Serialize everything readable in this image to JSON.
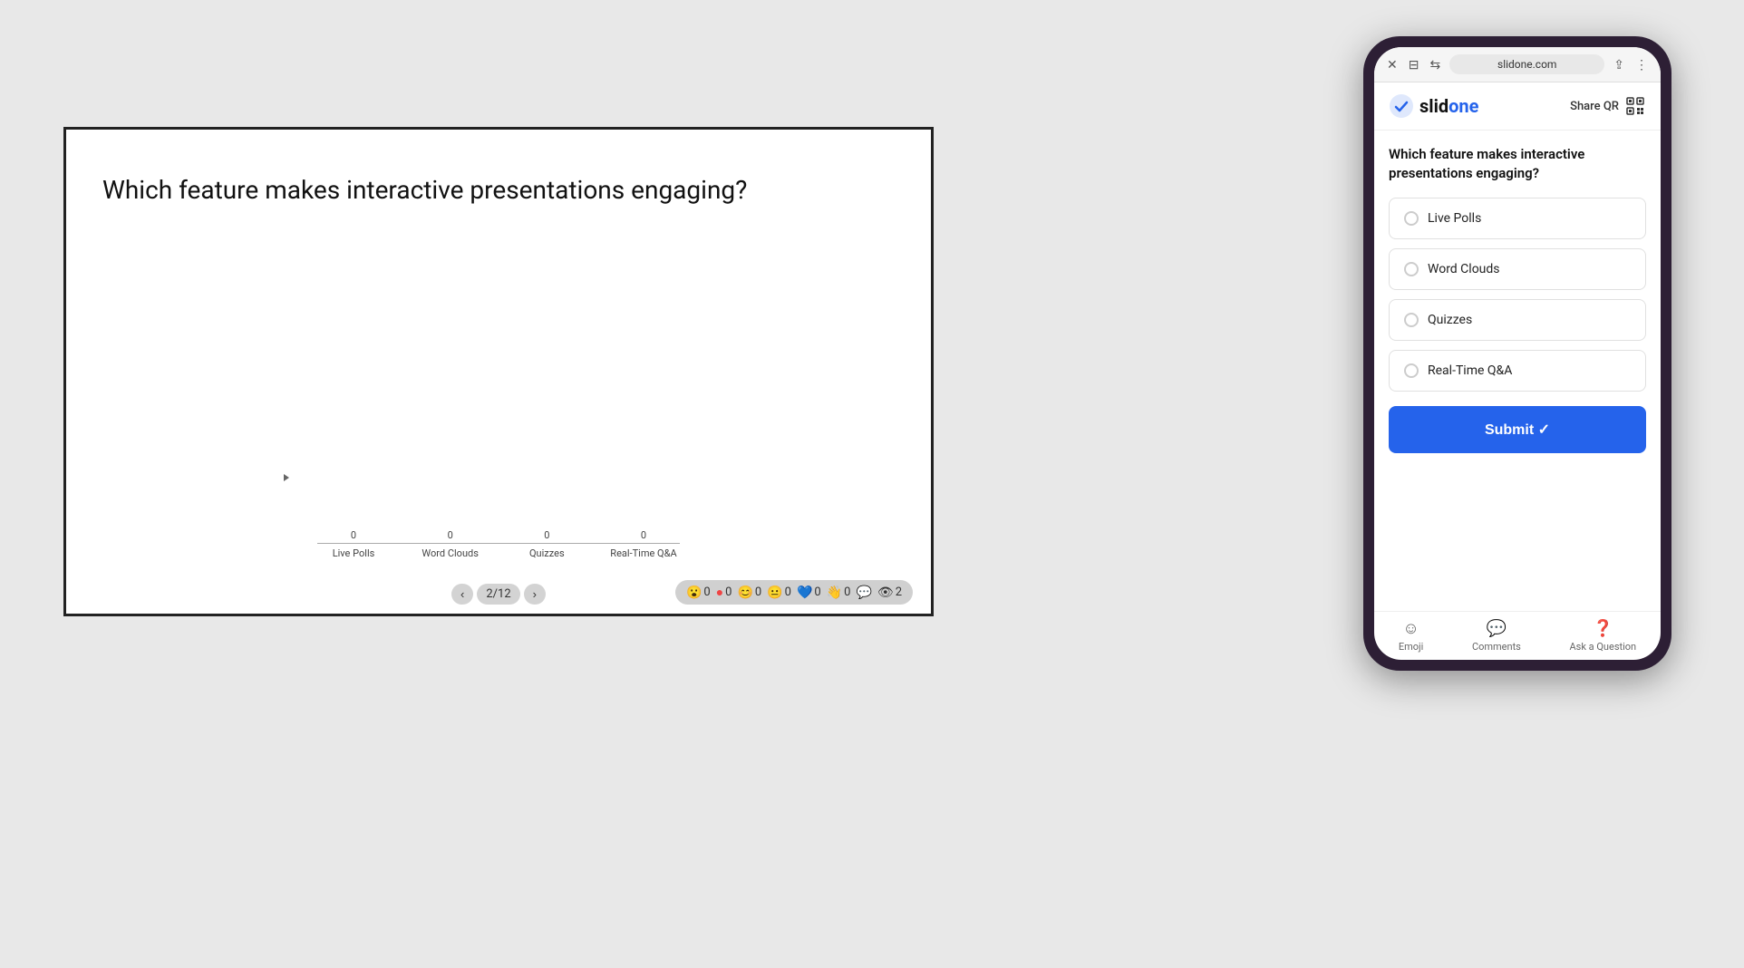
{
  "scene": {
    "background_color": "#e8e8e8"
  },
  "slide": {
    "title": "Which feature makes interactive presentations engaging?",
    "border_color": "#222",
    "chart": {
      "labels": [
        "Live Polls",
        "Word Clouds",
        "Quizzes",
        "Real-Time Q&A"
      ],
      "values": [
        0,
        0,
        0,
        0
      ]
    },
    "navigation": {
      "current": 2,
      "total": 12,
      "prev_label": "‹",
      "next_label": "›",
      "page_label": "2/12"
    },
    "reactions": [
      {
        "icon": "😮",
        "count": "0",
        "color": "#f59e0b"
      },
      {
        "icon": "🔴",
        "count": "0",
        "color": "#ef4444"
      },
      {
        "icon": "😊",
        "count": "0",
        "color": "#f59e0b"
      },
      {
        "icon": "😐",
        "count": "0",
        "color": "#f59e0b"
      },
      {
        "icon": "💙",
        "count": "0",
        "color": "#3b82f6"
      },
      {
        "icon": "👋",
        "count": "0",
        "color": "#6b7280"
      },
      {
        "icon": "💬",
        "count": "",
        "color": "#6b7280"
      },
      {
        "icon": "👁",
        "count": "2",
        "color": "#6b7280"
      }
    ]
  },
  "phone": {
    "browser": {
      "url": "slidone.com",
      "close_label": "✕",
      "tab_label": "⊟",
      "share_label": "⇪",
      "more_label": "⋮"
    },
    "app": {
      "logo_text": "slidone",
      "logo_check": "✓",
      "share_qr_label": "Share QR",
      "poll_question": "Which feature makes interactive presentations engaging?",
      "options": [
        {
          "label": "Live Polls"
        },
        {
          "label": "Word Clouds"
        },
        {
          "label": "Quizzes"
        },
        {
          "label": "Real-Time Q&A"
        }
      ],
      "submit_label": "Submit ✓",
      "bottom_bar": [
        {
          "icon": "😊",
          "label": "Emoji"
        },
        {
          "icon": "💬",
          "label": "Comments"
        },
        {
          "icon": "❓",
          "label": "Ask a Question"
        }
      ]
    }
  }
}
